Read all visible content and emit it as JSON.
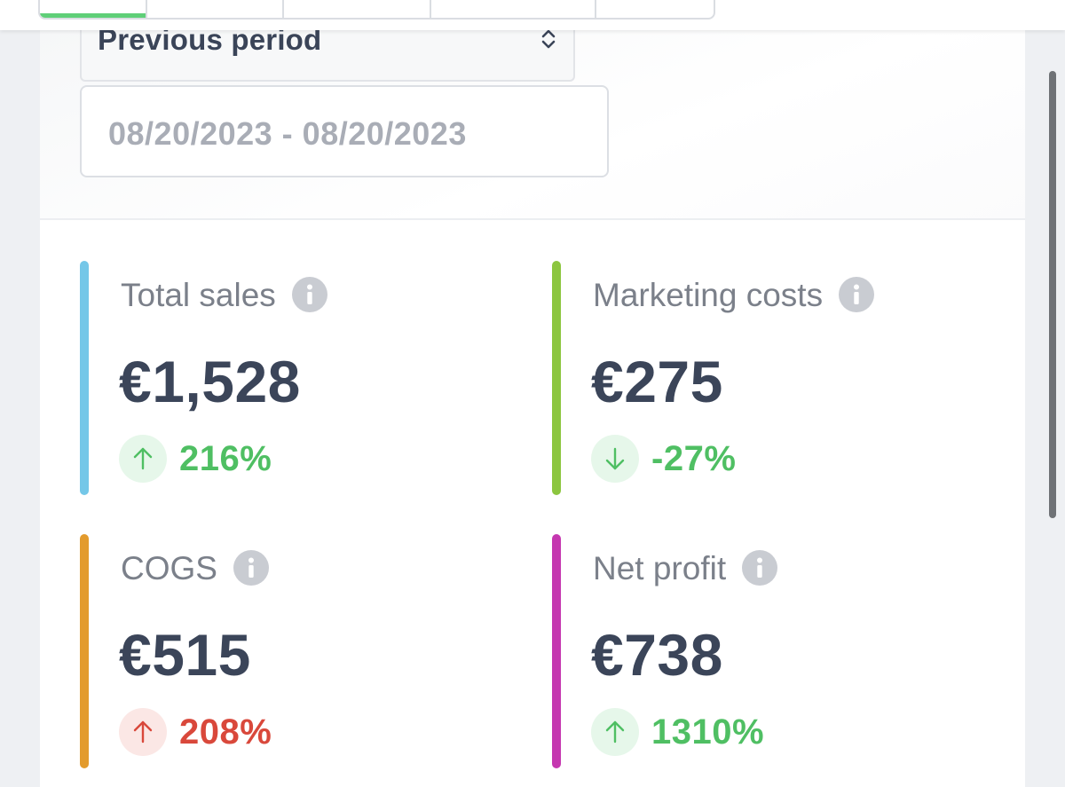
{
  "comparison": {
    "selected": "Previous period",
    "date_range": "08/20/2023 - 08/20/2023"
  },
  "metrics": [
    {
      "label": "Total sales",
      "value": "€1,528",
      "change": "216%",
      "direction": "up",
      "bar_color": "#74c7e8",
      "change_color": "#4fbf63"
    },
    {
      "label": "Marketing costs",
      "value": "€275",
      "change": "-27%",
      "direction": "down",
      "bar_color": "#8cc63f",
      "change_color": "#4fbf63"
    },
    {
      "label": "COGS",
      "value": "€515",
      "change": "208%",
      "direction": "up",
      "bar_color": "#e39b2d",
      "change_color": "#d9483b"
    },
    {
      "label": "Net profit",
      "value": "€738",
      "change": "1310%",
      "direction": "up",
      "bar_color": "#c537b0",
      "change_color": "#4fbf63"
    }
  ]
}
